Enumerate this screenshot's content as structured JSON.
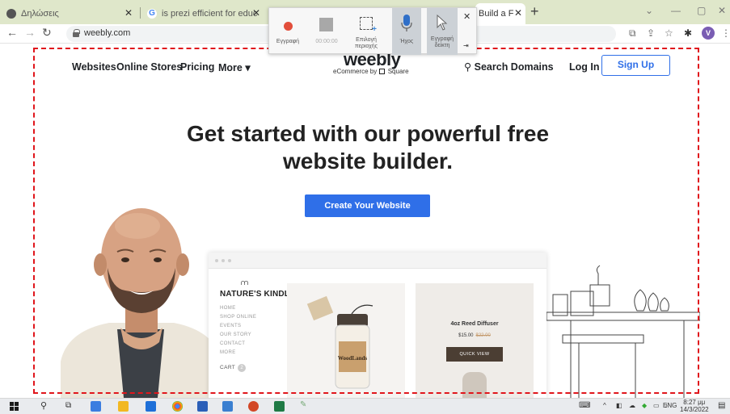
{
  "browser": {
    "tabs": [
      {
        "title": "Δηλώσεις",
        "color": "#555555"
      },
      {
        "title": "is prezi efficient for education - ",
        "color": "#4285f4"
      },
      {
        "title": "Build a Free",
        "color": "#333333"
      }
    ],
    "url": "weebly.com",
    "profile_initial": "V"
  },
  "recorder": {
    "record_label": "Εγγραφή",
    "timer": "00:00:00",
    "select_area_label": "Επιλογή περιοχής",
    "audio_label": "Ήχος",
    "cursor_label": "Εγγραφή δείκτη"
  },
  "site": {
    "nav": {
      "websites": "Websites",
      "online_stores": "Online Stores",
      "pricing": "Pricing",
      "more": "More ▾"
    },
    "logo": "weebly",
    "logo_sub_prefix": "eCommerce by",
    "logo_sub_brand": "Square",
    "search_domains": "Search Domains",
    "login": "Log In",
    "signup": "Sign Up",
    "headline_line1": "Get started with our powerful free",
    "headline_line2": "website builder.",
    "cta": "Create Your Website",
    "preview": {
      "store_name": "NATURE'S KINDLE",
      "menu": [
        "HOME",
        "SHOP ONLINE",
        "EVENTS",
        "OUR STORY",
        "CONTACT",
        "MORE"
      ],
      "cart": "CART",
      "cart_count": "2",
      "jar_label": "WoodLands",
      "product_title": "4oz Reed Diffuser",
      "price": "$15.00",
      "old_price": "$22.00",
      "quick_view": "QUICK VIEW"
    }
  },
  "taskbar": {
    "lang": "ENG",
    "time": "8:27 μμ",
    "date": "14/3/2022"
  },
  "colors": {
    "accent": "#2f6fe8",
    "dashed_border": "#e0161c",
    "tabstrip": "#dfe7ca"
  }
}
